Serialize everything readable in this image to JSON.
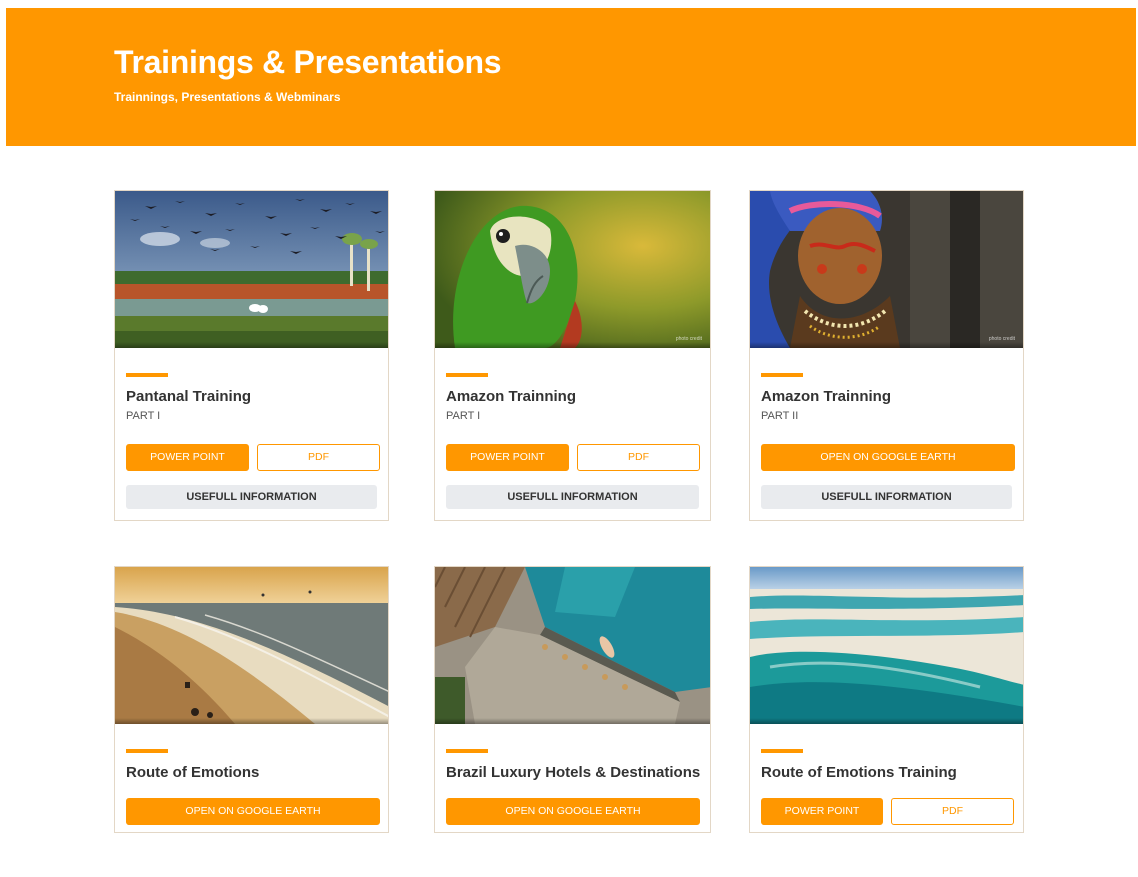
{
  "header": {
    "title": "Trainings & Presentations",
    "subtitle": "Trainnings, Presentations & Webminars"
  },
  "cards": [
    {
      "title": "Pantanal Training",
      "part": "PART I",
      "image": "pantanal-birds-photo",
      "buttons": [
        {
          "label": "POWER POINT",
          "style": "solid"
        },
        {
          "label": "PDF",
          "style": "outline"
        },
        {
          "label": "USEFULL INFORMATION",
          "style": "grey"
        }
      ]
    },
    {
      "title": "Amazon Trainning",
      "part": "PART I",
      "image": "amazon-parrot-photo",
      "caption": "photo credit",
      "buttons": [
        {
          "label": "POWER POINT",
          "style": "solid"
        },
        {
          "label": "PDF",
          "style": "outline"
        },
        {
          "label": "USEFULL INFORMATION",
          "style": "grey"
        }
      ]
    },
    {
      "title": "Amazon Trainning",
      "part": "PART II",
      "image": "indigenous-elder-photo",
      "caption": "photo credit",
      "buttons": [
        {
          "label": "OPEN ON GOOGLE EARTH",
          "style": "solid"
        },
        {
          "label": "USEFULL INFORMATION",
          "style": "grey"
        }
      ]
    },
    {
      "title": "Route of Emotions",
      "image": "beach-dunes-photo",
      "buttons": [
        {
          "label": "OPEN ON GOOGLE EARTH",
          "style": "solid"
        }
      ]
    },
    {
      "title": "Brazil Luxury Hotels & Destinations",
      "image": "luxury-pool-photo",
      "buttons": [
        {
          "label": "OPEN ON GOOGLE EARTH",
          "style": "solid"
        }
      ]
    },
    {
      "title": "Route of Emotions Training",
      "image": "lencois-lagoons-photo",
      "buttons": [
        {
          "label": "POWER POINT",
          "style": "solid"
        },
        {
          "label": "PDF",
          "style": "outline"
        }
      ]
    }
  ],
  "colors": {
    "accent": "#ff9700",
    "grey_button": "#e9ebee",
    "text": "#333333"
  }
}
